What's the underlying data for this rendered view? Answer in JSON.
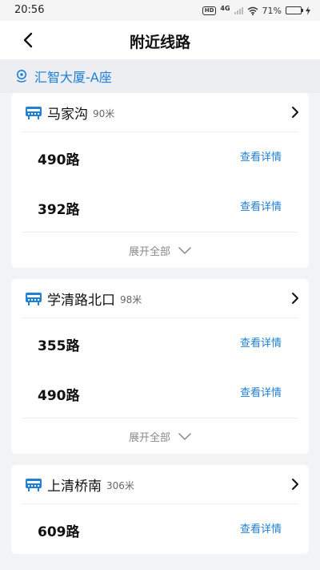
{
  "status_bar": {
    "time": "20:56",
    "hd": "HD",
    "network": "4G",
    "battery_pct": "71%",
    "battery_level": 0.71
  },
  "header": {
    "title": "附近线路"
  },
  "location": {
    "name": "汇智大厦-A座"
  },
  "stops": [
    {
      "name": "马家沟",
      "distance": "90米",
      "routes": [
        {
          "name": "490路",
          "action": "查看详情"
        },
        {
          "name": "392路",
          "action": "查看详情"
        }
      ],
      "expand_label": "展开全部"
    },
    {
      "name": "学清路北口",
      "distance": "98米",
      "routes": [
        {
          "name": "355路",
          "action": "查看详情"
        },
        {
          "name": "490路",
          "action": "查看详情"
        }
      ],
      "expand_label": "展开全部"
    },
    {
      "name": "上清桥南",
      "distance": "306米",
      "routes": [
        {
          "name": "609路",
          "action": "查看详情"
        }
      ]
    }
  ],
  "colors": {
    "accent": "#1f80d6",
    "background": "#f2f3f5",
    "card": "#ffffff"
  }
}
